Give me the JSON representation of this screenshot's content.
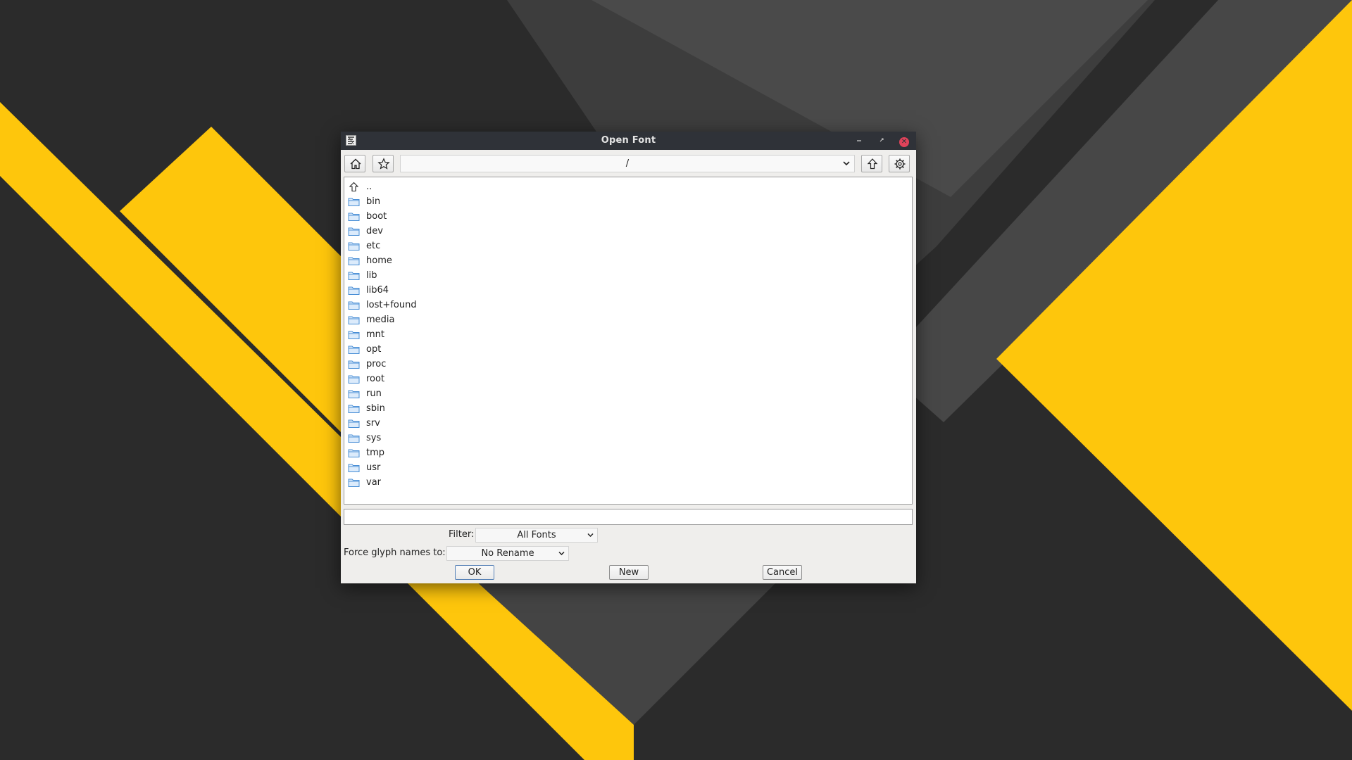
{
  "window": {
    "title": "Open Font"
  },
  "toolbar": {
    "path": "/"
  },
  "file_list": {
    "items": [
      {
        "label": "..",
        "icon": "up-arrow-icon"
      },
      {
        "label": "bin",
        "icon": "folder-icon"
      },
      {
        "label": "boot",
        "icon": "folder-icon"
      },
      {
        "label": "dev",
        "icon": "folder-icon"
      },
      {
        "label": "etc",
        "icon": "folder-icon"
      },
      {
        "label": "home",
        "icon": "folder-icon"
      },
      {
        "label": "lib",
        "icon": "folder-icon"
      },
      {
        "label": "lib64",
        "icon": "folder-icon"
      },
      {
        "label": "lost+found",
        "icon": "folder-icon"
      },
      {
        "label": "media",
        "icon": "folder-icon"
      },
      {
        "label": "mnt",
        "icon": "folder-icon"
      },
      {
        "label": "opt",
        "icon": "folder-icon"
      },
      {
        "label": "proc",
        "icon": "folder-icon"
      },
      {
        "label": "root",
        "icon": "folder-icon"
      },
      {
        "label": "run",
        "icon": "folder-icon"
      },
      {
        "label": "sbin",
        "icon": "folder-icon"
      },
      {
        "label": "srv",
        "icon": "folder-icon"
      },
      {
        "label": "sys",
        "icon": "folder-icon"
      },
      {
        "label": "tmp",
        "icon": "folder-icon"
      },
      {
        "label": "usr",
        "icon": "folder-icon"
      },
      {
        "label": "var",
        "icon": "folder-icon"
      }
    ]
  },
  "filename": {
    "value": ""
  },
  "filter": {
    "label": "Filter:",
    "selected": "All Fonts"
  },
  "glyph_names": {
    "label": "Force glyph names to:",
    "selected": "No Rename"
  },
  "buttons": {
    "ok": "OK",
    "new": "New",
    "cancel": "Cancel"
  },
  "colors": {
    "titlebar": "#2f3238",
    "close_button": "#e0435a",
    "folder_icon": "#4a8fd6",
    "wallpaper_dark": "#2b2b2b",
    "wallpaper_gray": "#4a4a4a",
    "wallpaper_yellow": "#fec60c"
  }
}
